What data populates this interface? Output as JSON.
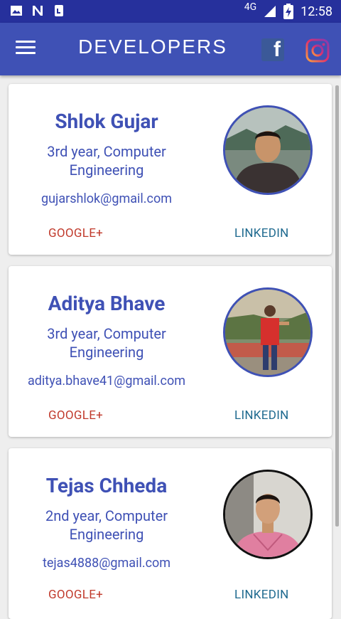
{
  "status_bar": {
    "network": "4G",
    "time": "12:58"
  },
  "app_bar": {
    "title": "DEVELOPERS"
  },
  "developers": [
    {
      "name": "Shlok Gujar",
      "year_line1": "3rd year, Computer",
      "year_line2": "Engineering",
      "email": "gujarshlok@gmail.com",
      "google_label": "GOOGLE+",
      "linkedin_label": "LINKEDIN"
    },
    {
      "name": "Aditya Bhave",
      "year_line1": "3rd year, Computer",
      "year_line2": "Engineering",
      "email": "aditya.bhave41@gmail.com",
      "google_label": "GOOGLE+",
      "linkedin_label": "LINKEDIN"
    },
    {
      "name": "Tejas Chheda",
      "year_line1": "2nd year, Computer",
      "year_line2": "Engineering",
      "email": "tejas4888@gmail.com",
      "google_label": "GOOGLE+",
      "linkedin_label": "LINKEDIN"
    }
  ],
  "colors": {
    "status_bar": "#26309c",
    "app_bar": "#3f51b5",
    "name_text": "#3f51b5",
    "google_button": "#c0392b",
    "linkedin_button": "#1f6a8f"
  },
  "icons": {
    "status_left": [
      "image-icon",
      "n-notification-icon",
      "calendar-icon"
    ],
    "status_right": [
      "signal-icon",
      "battery-charging-icon"
    ],
    "app_bar": [
      "menu-icon",
      "facebook-icon",
      "instagram-icon"
    ]
  }
}
